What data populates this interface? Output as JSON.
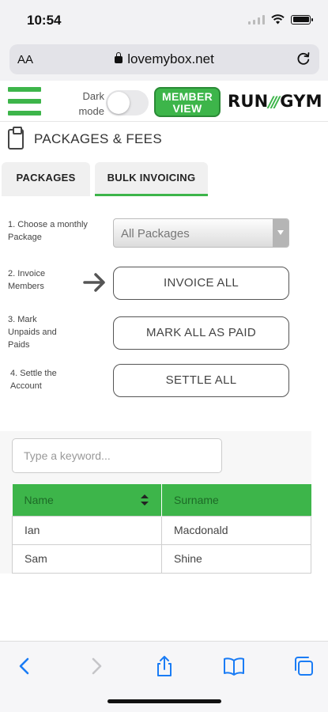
{
  "status_bar": {
    "time": "10:54",
    "icons": [
      "signal-icon",
      "wifi-icon",
      "battery-icon"
    ]
  },
  "browser": {
    "text_size_label": "AA",
    "url": "lovemybox.net",
    "icons": [
      "lock-icon",
      "reload-icon"
    ]
  },
  "header": {
    "dark_mode_line1": "Dark",
    "dark_mode_line2": "mode",
    "dark_mode_on": false,
    "member_view_line1": "MEMBER",
    "member_view_line2": "VIEW",
    "logo_left": "RUN",
    "logo_right": "GYM"
  },
  "page": {
    "title": "PACKAGES & FEES"
  },
  "tabs": [
    {
      "label": "PACKAGES",
      "active": false
    },
    {
      "label": "BULK INVOICING",
      "active": true
    }
  ],
  "steps": [
    {
      "label_lines": [
        "1. Choose a monthly",
        "Package"
      ]
    },
    {
      "label_lines": [
        "2. Invoice",
        "Members"
      ]
    },
    {
      "label_lines": [
        "3. Mark",
        "Unpaids and",
        "Paids"
      ]
    },
    {
      "label_lines": [
        "4. Settle the",
        "Account"
      ]
    }
  ],
  "package_select": {
    "selected": "All Packages"
  },
  "buttons": {
    "invoice_all": "INVOICE ALL",
    "mark_all_paid": "MARK ALL AS PAID",
    "settle_all": "SETTLE ALL"
  },
  "search": {
    "placeholder": "Type a keyword...",
    "value": ""
  },
  "table": {
    "columns": [
      "Name",
      "Surname"
    ],
    "rows": [
      [
        "Ian",
        "Macdonald"
      ],
      [
        "Sam",
        "Shine"
      ]
    ]
  },
  "colors": {
    "accent_green": "#3db54a",
    "header_text_green": "#1d6a27"
  },
  "toolbar_icons": [
    "back-icon",
    "forward-icon",
    "share-icon",
    "bookmarks-icon",
    "tabs-icon"
  ]
}
